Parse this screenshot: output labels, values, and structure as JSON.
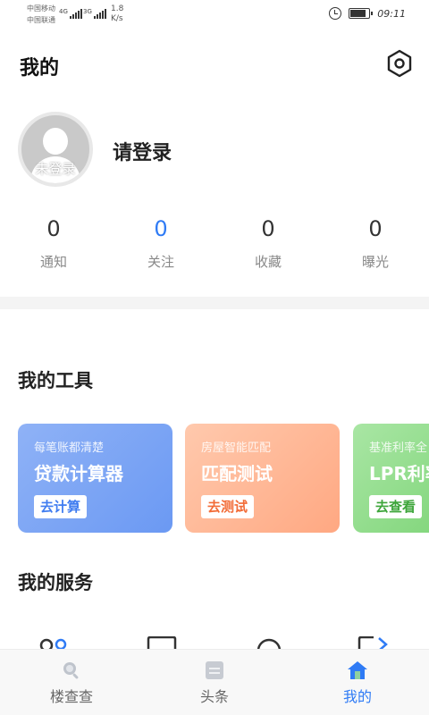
{
  "status_bar": {
    "carrier_1": "中国移动",
    "carrier_2": "中国联通",
    "signal_1": "4G",
    "signal_2": "3G",
    "speed_value": "1.8",
    "speed_unit": "K/s",
    "time": "09:11"
  },
  "header": {
    "title": "我的",
    "settings_icon": "hexagon-settings-icon"
  },
  "profile": {
    "avatar_caption": "未登录",
    "login_prompt": "请登录"
  },
  "stats": [
    {
      "count": "0",
      "label": "通知"
    },
    {
      "count": "0",
      "label": "关注"
    },
    {
      "count": "0",
      "label": "收藏"
    },
    {
      "count": "0",
      "label": "曝光"
    }
  ],
  "tools": {
    "title": "我的工具",
    "cards": [
      {
        "subtitle": "每笔账都清楚",
        "title": "贷款计算器",
        "button": "去计算",
        "color": "#6b99f3"
      },
      {
        "subtitle": "房屋智能匹配",
        "title": "匹配测试",
        "button": "去测试",
        "color": "#ffa882"
      },
      {
        "subtitle": "基准利率全",
        "title": "LPR利率",
        "button": "去查看",
        "color": "#82d67c"
      }
    ]
  },
  "services": {
    "title": "我的服务"
  },
  "tabbar": {
    "active_color": "#2f7bf5",
    "items": [
      {
        "label": "楼查查",
        "icon": "search-icon"
      },
      {
        "label": "头条",
        "icon": "news-icon"
      },
      {
        "label": "我的",
        "icon": "home-icon"
      }
    ]
  }
}
